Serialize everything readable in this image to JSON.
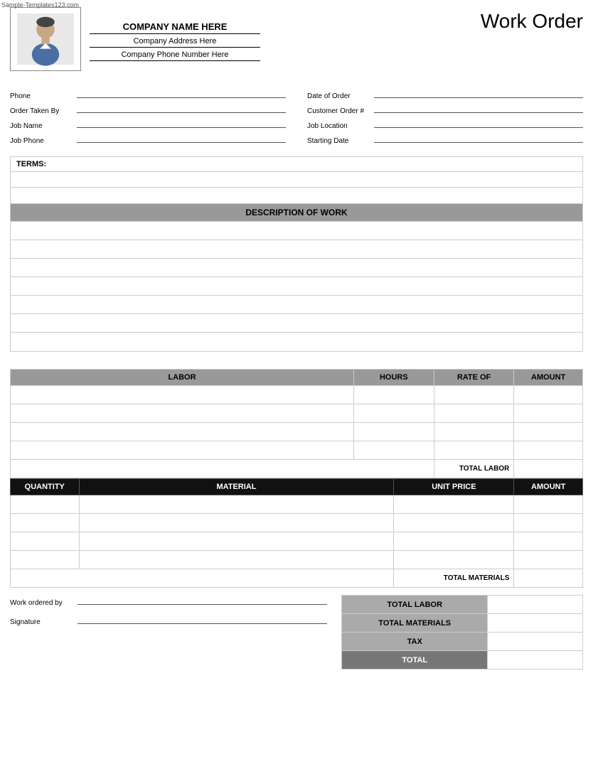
{
  "watermark": "Sample-Templates123.com",
  "header": {
    "company_name": "COMPANY NAME HERE",
    "company_address": "Company Address Here",
    "company_phone": "Company Phone Number Here",
    "title": "Work Order"
  },
  "fields": {
    "left": [
      {
        "label": "Phone",
        "value": ""
      },
      {
        "label": "Order Taken By",
        "value": ""
      },
      {
        "label": "Job Name",
        "value": ""
      },
      {
        "label": "Job Phone",
        "value": ""
      }
    ],
    "right": [
      {
        "label": "Date of Order",
        "value": ""
      },
      {
        "label": "Customer Order #",
        "value": ""
      },
      {
        "label": "Job Location",
        "value": ""
      },
      {
        "label": "Starting Date",
        "value": ""
      }
    ]
  },
  "terms": {
    "label": "TERMS:",
    "rows": 3
  },
  "description_of_work": {
    "label": "DESCRIPTION OF WORK",
    "rows": 7
  },
  "labor": {
    "columns": [
      "LABOR",
      "HOURS",
      "RATE OF",
      "AMOUNT"
    ],
    "col_widths": [
      "60%",
      "14%",
      "14%",
      "12%"
    ],
    "rows": 4,
    "total_label": "TOTAL LABOR"
  },
  "materials": {
    "columns": [
      "QUANTITY",
      "MATERIAL",
      "UNIT PRICE",
      "AMOUNT"
    ],
    "col_widths": [
      "12%",
      "55%",
      "21%",
      "12%"
    ],
    "rows": 4,
    "total_label": "TOTAL MATERIALS"
  },
  "summary": {
    "rows": [
      {
        "label": "TOTAL LABOR",
        "dark": false
      },
      {
        "label": "TOTAL MATERIALS",
        "dark": false
      },
      {
        "label": "TAX",
        "dark": false
      },
      {
        "label": "TOTAL",
        "dark": true
      }
    ],
    "work_ordered_by_label": "Work ordered by",
    "signature_label": "Signature"
  }
}
